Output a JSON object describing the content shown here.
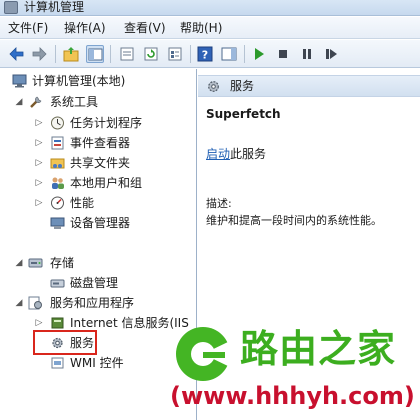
{
  "window": {
    "title": "计算机管理"
  },
  "menu": [
    "文件(F)",
    "操作(A)",
    "查看(V)",
    "帮助(H)"
  ],
  "toolbar_icons": [
    "back-arrow-icon",
    "forward-arrow-icon",
    "folder-up-icon",
    "console-tree-icon",
    "export-icon",
    "refresh-icon",
    "properties-icon",
    "help-icon",
    "action-pane-icon",
    "play-icon",
    "stop-icon",
    "pause-icon",
    "restart-icon"
  ],
  "tree": {
    "root": "计算机管理(本地)",
    "system_tools": "系统工具",
    "task_scheduler": "任务计划程序",
    "event_viewer": "事件查看器",
    "shared_folders": "共享文件夹",
    "local_users": "本地用户和组",
    "performance": "性能",
    "device_manager": "设备管理器",
    "storage": "存储",
    "disk_management": "磁盘管理",
    "services_apps": "服务和应用程序",
    "iis": "Internet 信息服务(IIS",
    "services": "服务",
    "wmi": "WMI 控件"
  },
  "right": {
    "header": "服务",
    "service_name": "Superfetch",
    "start_link": "启动",
    "start_suffix": "此服务",
    "desc_label": "描述:",
    "desc": "维护和提高一段时间内的系统性能。"
  },
  "watermark": {
    "brand": "路由之家",
    "url": "(www.hhhyh.com)"
  },
  "colors": {
    "accent": "#1f5fb4",
    "highlight": "#d9261c",
    "brand_green": "#3cae1f",
    "brand_red": "#c8102e"
  }
}
